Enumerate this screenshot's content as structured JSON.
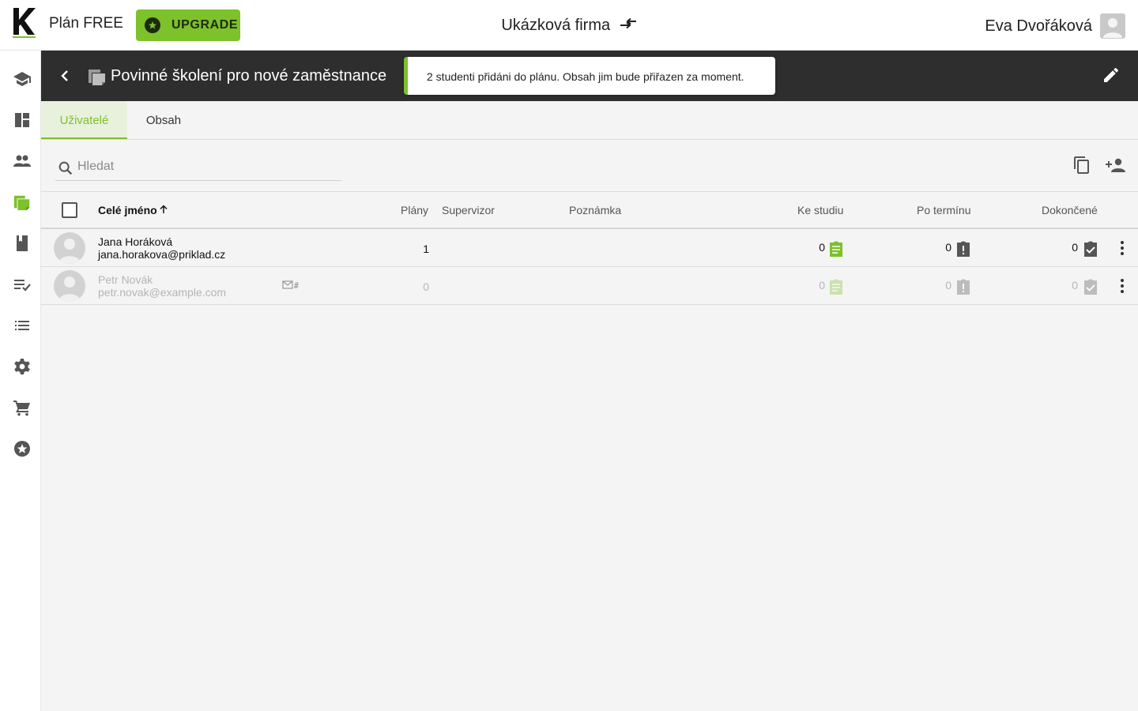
{
  "topbar": {
    "plan_label": "Plán FREE",
    "upgrade_label": "UPGRADE",
    "company": "Ukázková firma",
    "user_name": "Eva Dvořáková"
  },
  "sidebar": {
    "items": [
      {
        "icon": "school-icon"
      },
      {
        "icon": "dashboard-icon"
      },
      {
        "icon": "people-icon"
      },
      {
        "icon": "plans-icon",
        "active": true
      },
      {
        "icon": "book-icon"
      },
      {
        "icon": "checklist-icon"
      },
      {
        "icon": "list-icon"
      },
      {
        "icon": "gear-icon"
      },
      {
        "icon": "cart-icon"
      },
      {
        "icon": "star-icon"
      }
    ]
  },
  "header": {
    "title": "Povinné školení pro nové zaměstnance"
  },
  "toast": {
    "message": "2 studenti přidáni do plánu. Obsah jim bude přiřazen za moment."
  },
  "tabs": [
    {
      "label": "Uživatelé",
      "active": true
    },
    {
      "label": "Obsah",
      "active": false
    }
  ],
  "search": {
    "placeholder": "Hledat",
    "value": ""
  },
  "table": {
    "columns": {
      "name": "Celé jméno",
      "plans": "Plány",
      "supervisor": "Supervizor",
      "note": "Poznámka",
      "to_study": "Ke studiu",
      "overdue": "Po termínu",
      "done": "Dokončené"
    },
    "rows": [
      {
        "name": "Jana Horáková",
        "email": "jana.horakova@priklad.cz",
        "plans": "1",
        "to_study": "0",
        "overdue": "0",
        "done": "0",
        "invited": false
      },
      {
        "name": "Petr Novák",
        "email": "petr.novak@example.com",
        "plans": "0",
        "to_study": "0",
        "overdue": "0",
        "done": "0",
        "invited": true
      }
    ]
  },
  "colors": {
    "accent": "#7dc12b",
    "header_bg": "#2e2e2e",
    "page_bg": "#f4f4f4"
  }
}
